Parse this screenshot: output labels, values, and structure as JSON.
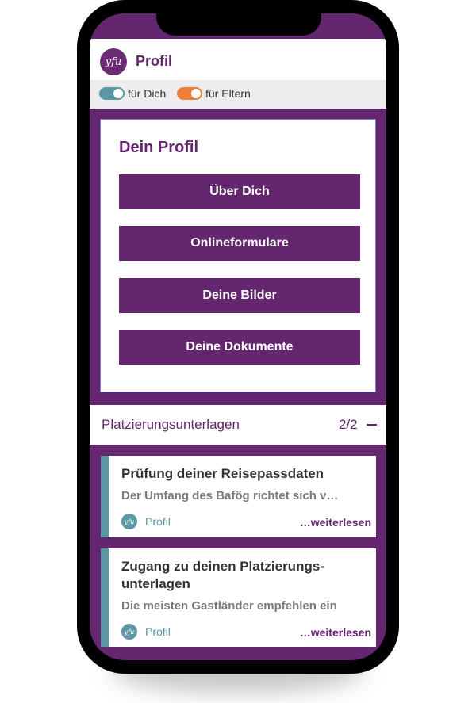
{
  "header": {
    "logo_text": "yfu",
    "title": "Profil"
  },
  "toggles": [
    {
      "label": "für Dich",
      "color": "#5b98a5",
      "on": true
    },
    {
      "label": "für Eltern",
      "color": "#f07c3a",
      "on": true
    }
  ],
  "profile_card": {
    "title": "Dein Profil",
    "buttons": [
      {
        "label": "Über Dich"
      },
      {
        "label": "Onlineformulare"
      },
      {
        "label": "Deine Bilder"
      },
      {
        "label": "Deine Dokumente"
      }
    ]
  },
  "section": {
    "title": "Platzierungsunterlagen",
    "count": "2/2"
  },
  "news": [
    {
      "title": "Prüfung deiner Reisepassdaten",
      "text": "Der Umfang des Bafög richtet sich v…",
      "category": "Profil",
      "read_more": "…weiterlesen"
    },
    {
      "title": "Zugang zu deinen Platzierungs-unterlagen",
      "text": "Die meisten Gastländer empfehlen ein",
      "category": "Profil",
      "read_more": "…weiterlesen"
    }
  ],
  "colors": {
    "brand_purple": "#64266e",
    "teal": "#5b98a5",
    "orange": "#f07c3a"
  }
}
